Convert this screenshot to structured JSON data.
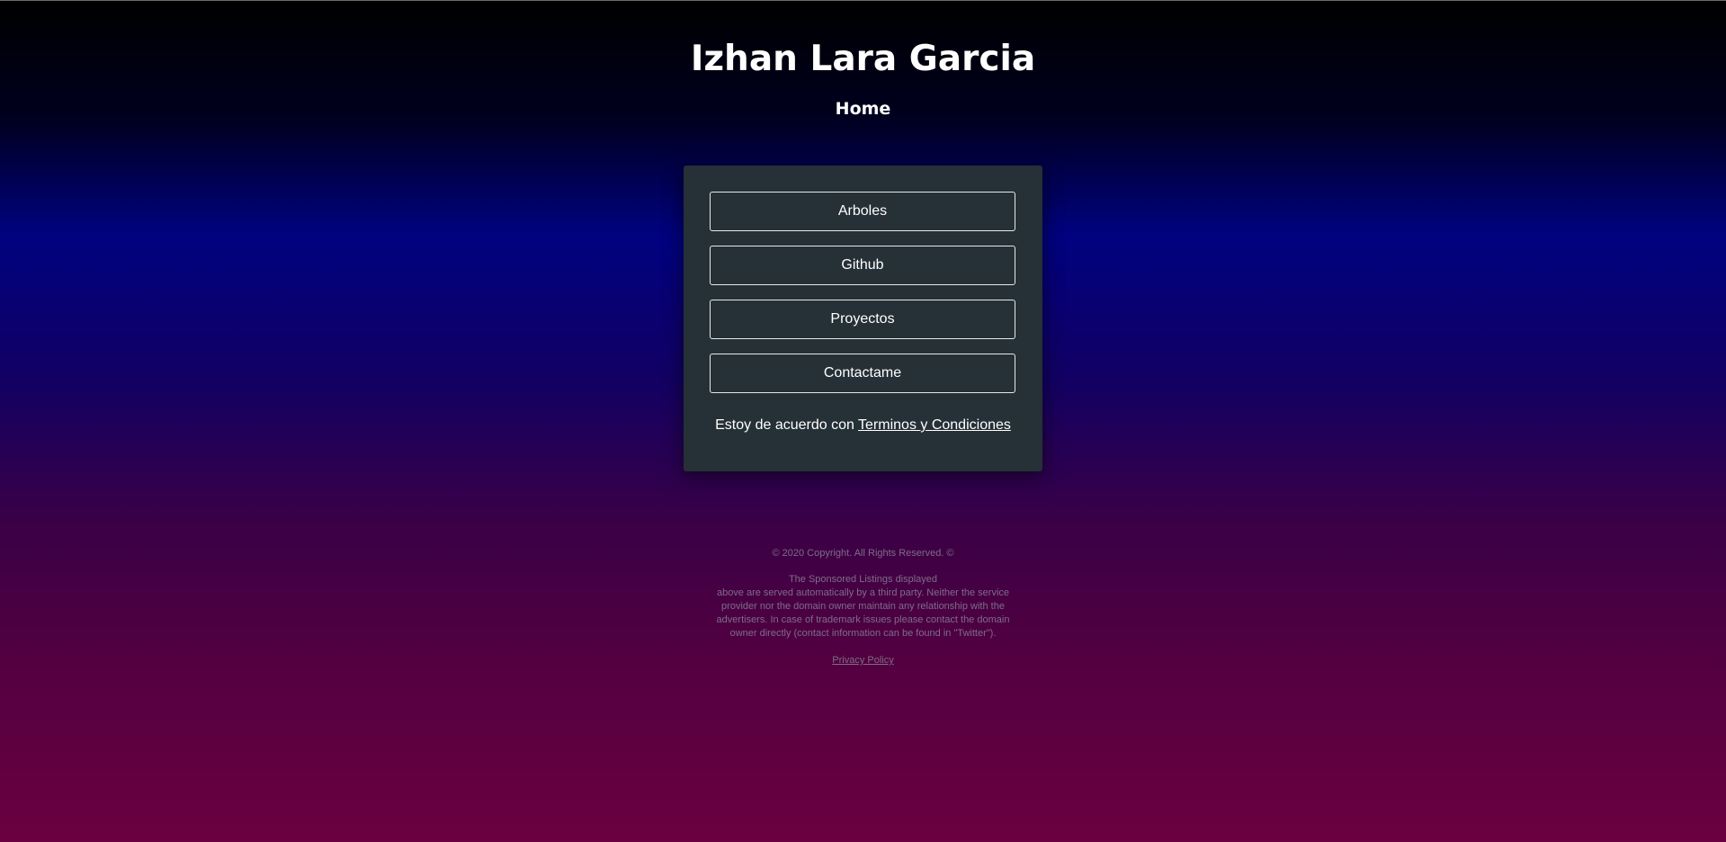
{
  "header": {
    "title": "Izhan Lara Garcia",
    "nav_home": "Home"
  },
  "menu": {
    "buttons": [
      "Arboles",
      "Github",
      "Proyectos",
      "Contactame"
    ],
    "terms_prefix": "Estoy de acuerdo con",
    "terms_link": "Terminos y Condiciones"
  },
  "footer": {
    "copyright": "© 2020 Copyright. All Rights Reserved. ©",
    "disclaimer_lines": [
      "The Sponsored Listings displayed",
      "above are served automatically by a third party. Neither the service",
      "provider nor the domain owner maintain any relationship with the",
      "advertisers. In case of trademark issues please contact the domain",
      "owner directly (contact information can be found in \"Twitter\")."
    ],
    "privacy_link": "Privacy Policy"
  },
  "colors": {
    "card_background": "#263037",
    "footer_text": "#7d6d88",
    "gradient_top": "#000000",
    "gradient_mid": "#000280",
    "gradient_bottom": "#6b0040"
  }
}
